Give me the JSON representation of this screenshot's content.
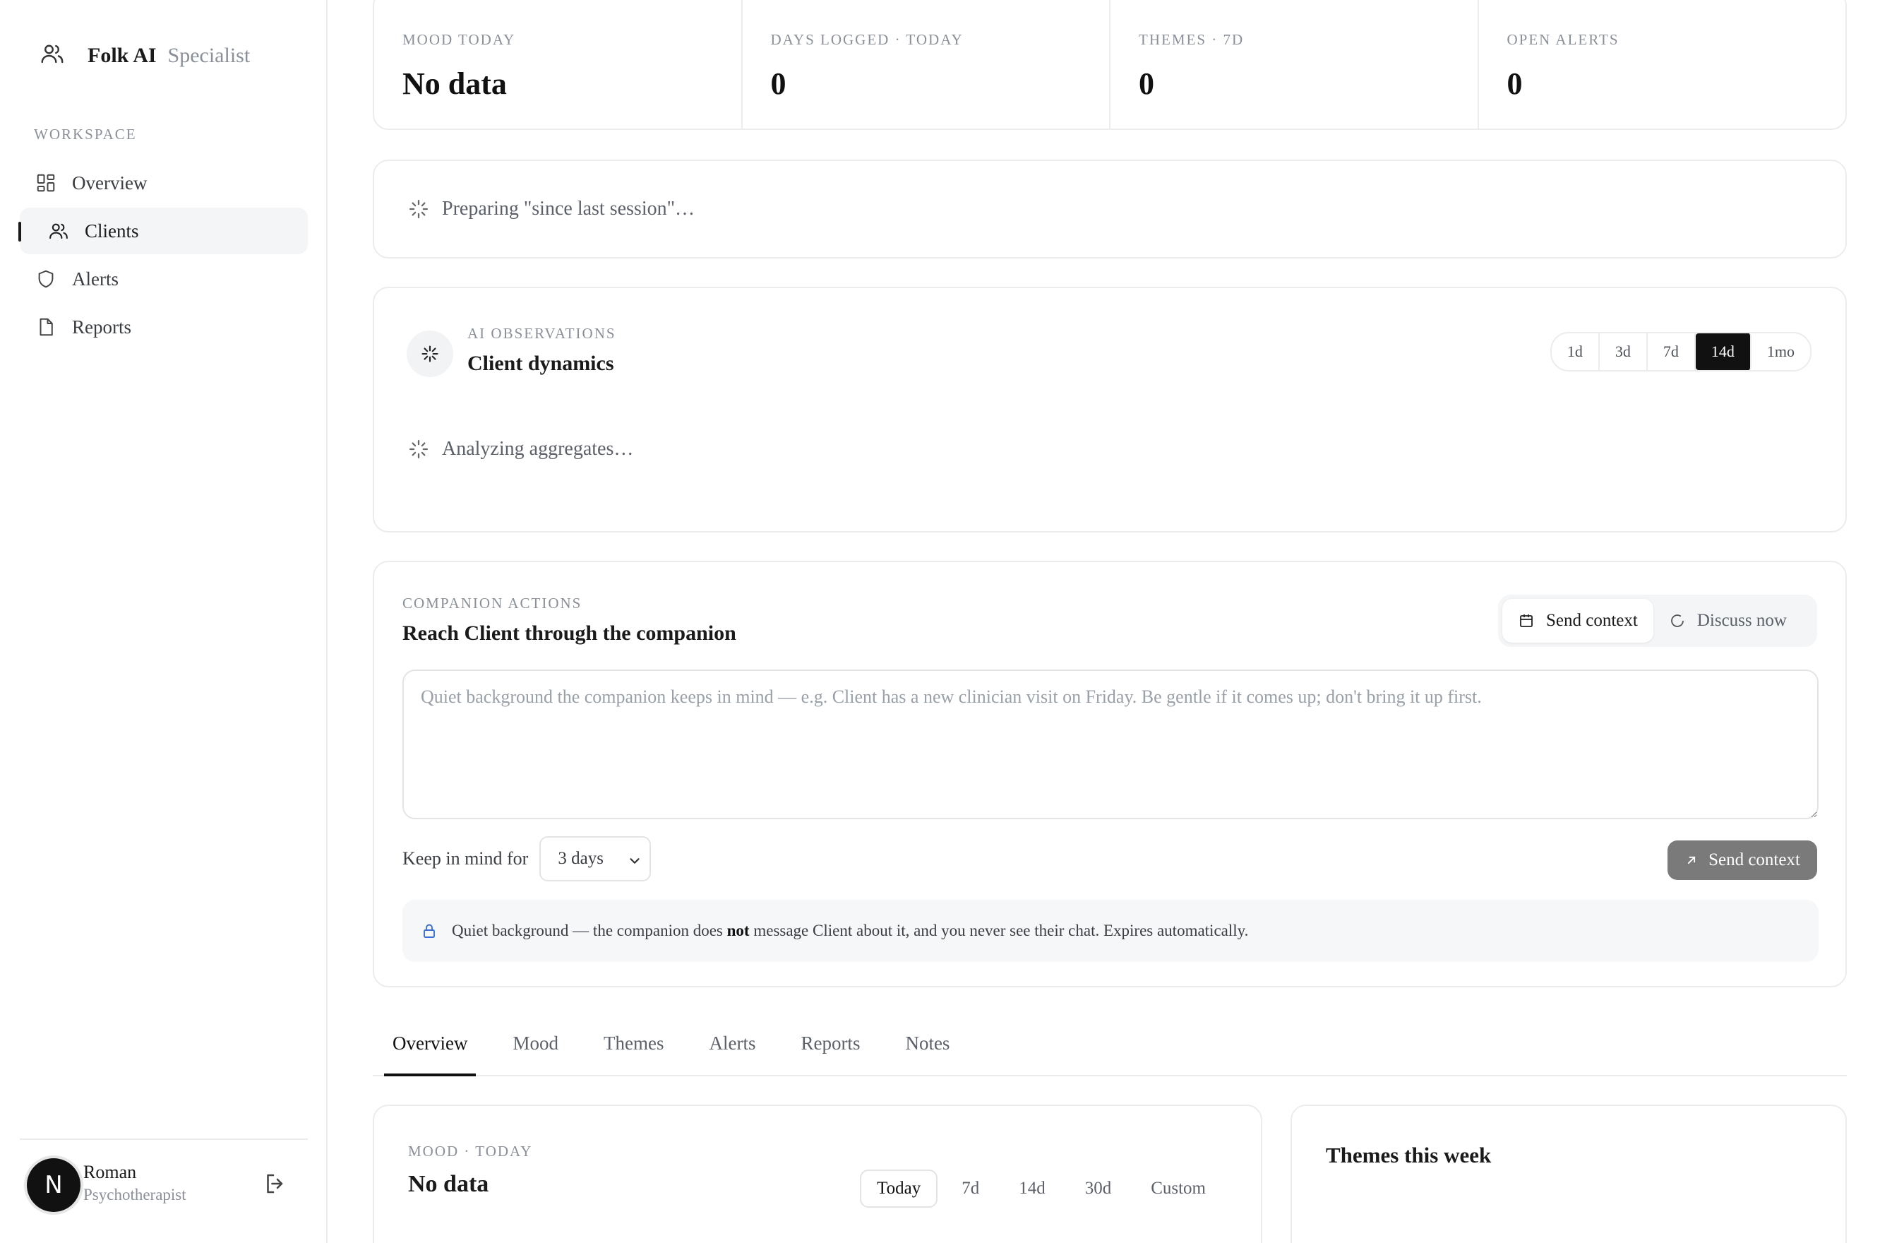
{
  "brand": {
    "name": "Folk AI",
    "sub": "Specialist"
  },
  "sidebar": {
    "section_label": "WORKSPACE",
    "items": [
      {
        "label": "Overview",
        "icon": "grid-icon"
      },
      {
        "label": "Clients",
        "icon": "users-icon",
        "active": true
      },
      {
        "label": "Alerts",
        "icon": "shield-icon"
      },
      {
        "label": "Reports",
        "icon": "file-icon"
      }
    ]
  },
  "user": {
    "initial": "N",
    "name": "Roman",
    "role": "Psychotherapist"
  },
  "stats": [
    {
      "label": "MOOD TODAY",
      "value": "No data"
    },
    {
      "label": "DAYS LOGGED · TODAY",
      "value": "0"
    },
    {
      "label": "THEMES · 7D",
      "value": "0"
    },
    {
      "label": "OPEN ALERTS",
      "value": "0"
    }
  ],
  "preparing": {
    "text": "Preparing \"since last session\"…"
  },
  "observations": {
    "label": "AI OBSERVATIONS",
    "title": "Client dynamics",
    "ranges": [
      "1d",
      "3d",
      "7d",
      "14d",
      "1mo"
    ],
    "selected_range": "14d",
    "status": "Analyzing aggregates…"
  },
  "companion": {
    "label": "COMPANION ACTIONS",
    "title": "Reach Client through the companion",
    "modes": [
      "Send context",
      "Discuss now"
    ],
    "active_mode": "Send context",
    "textarea_placeholder": "Quiet background the companion keeps in mind — e.g. Client has a new clinician visit on Friday. Be gentle if it comes up; don't bring it up first.",
    "keep_label": "Keep in mind for",
    "keep_value": "3 days",
    "send_label": "Send context",
    "note_before": "Quiet background — the companion does ",
    "note_bold": "not",
    "note_after": " message Client about it, and you never see their chat. Expires automatically."
  },
  "tabs": [
    "Overview",
    "Mood",
    "Themes",
    "Alerts",
    "Reports",
    "Notes"
  ],
  "active_tab": "Overview",
  "mood_card": {
    "label": "MOOD · TODAY",
    "value": "No data",
    "ranges": [
      "Today",
      "7d",
      "14d",
      "30d",
      "Custom"
    ],
    "selected_range": "Today"
  },
  "themes_card": {
    "title": "Themes this week"
  },
  "colors": {
    "accent": "#111111",
    "muted": "#8a8f98",
    "border": "#ececec",
    "send_disabled": "#7a7a7a"
  }
}
